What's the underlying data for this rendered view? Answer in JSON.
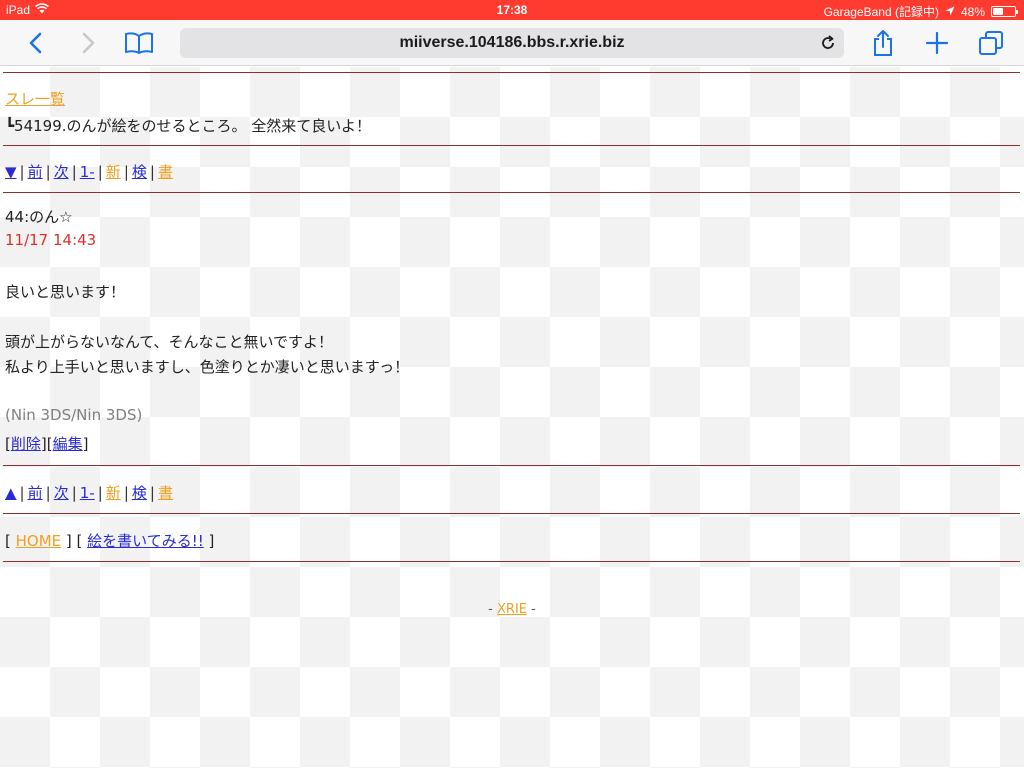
{
  "status_bar": {
    "device": "iPad",
    "time": "17:38",
    "recording_app": "GarageBand (記録中)",
    "battery_percent_text": "48%",
    "battery_level": 0.48
  },
  "browser": {
    "url": "miiverse.104186.bbs.r.xrie.biz"
  },
  "header": {
    "thread_list_link": "スレ一覧",
    "thread_title": "┗54199.のんが絵をのせるところ。 全然来て良いよ！"
  },
  "nav_top": {
    "down_arrow": "▼",
    "prev": "前",
    "next": "次",
    "first": "1-",
    "new": "新",
    "search": "検",
    "write": "書"
  },
  "post": {
    "author": "44:のん☆",
    "timestamp": "11/17 14:43",
    "body_lines": [
      "良いと思います！",
      "頭が上がらないなんて、そんなこと無いですよ！",
      "私より上手いと思いますし、色塗りとか凄いと思いますっ！"
    ],
    "device": "(Nin 3DS/Nin 3DS)",
    "delete_link": "削除",
    "edit_link": "編集"
  },
  "nav_bottom": {
    "up_arrow": "▲",
    "prev": "前",
    "next": "次",
    "first": "1-",
    "new": "新",
    "search": "検",
    "write": "書"
  },
  "footer_links": {
    "home": "HOME",
    "draw": "絵を書いてみる!!"
  },
  "credit": {
    "xrie": "XRIE"
  }
}
